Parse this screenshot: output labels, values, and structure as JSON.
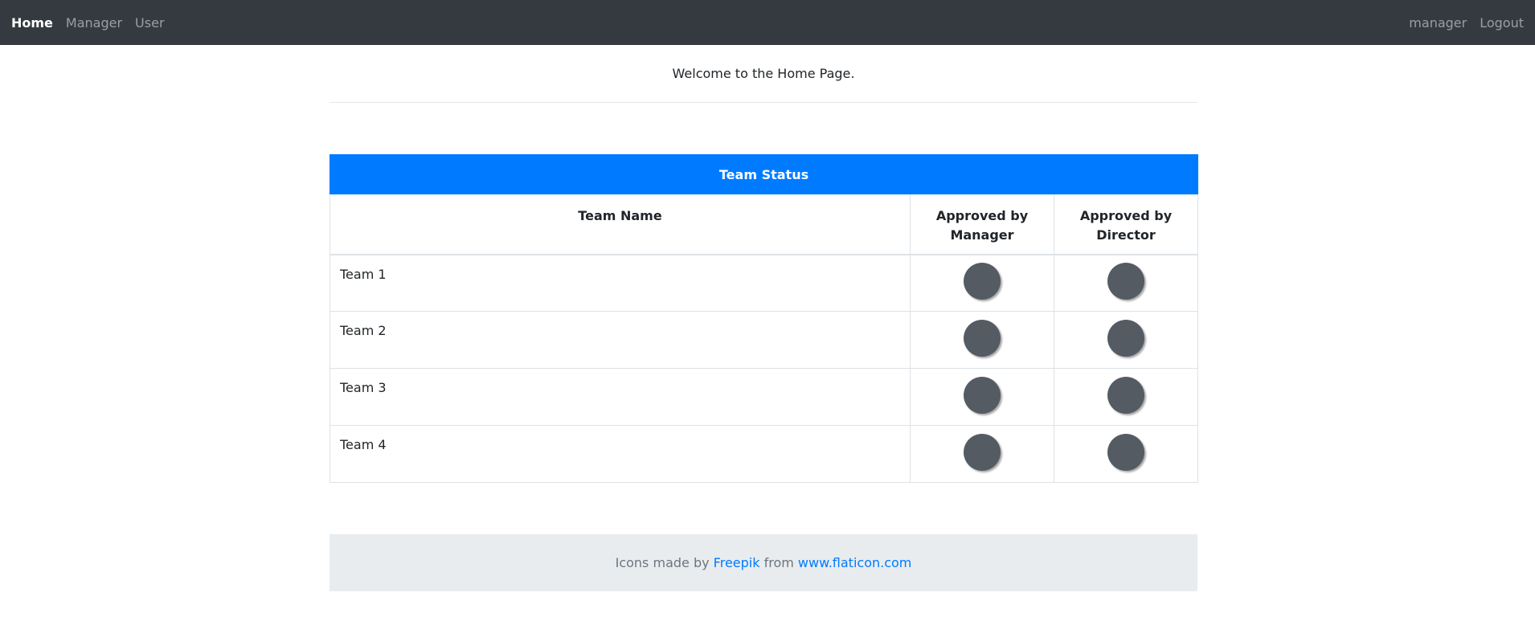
{
  "nav": {
    "brand": "Home",
    "links": [
      "Manager",
      "User"
    ],
    "user": "manager",
    "logout": "Logout"
  },
  "welcome": "Welcome to the Home Page.",
  "table": {
    "title": "Team Status",
    "columns": [
      "Team Name",
      "Approved by Manager",
      "Approved by Director"
    ],
    "rows": [
      {
        "name": "Team 1"
      },
      {
        "name": "Team 2"
      },
      {
        "name": "Team 3"
      },
      {
        "name": "Team 4"
      }
    ],
    "status_dot_color": "#545b63",
    "header_color": "#007bff"
  },
  "footer": {
    "prefix": "Icons made by",
    "author": "Freepik",
    "middle": "from",
    "site": "www.flaticon.com"
  }
}
